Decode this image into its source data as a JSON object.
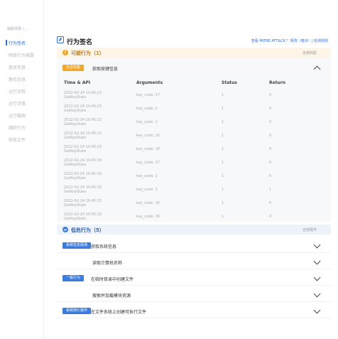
{
  "sidebar": {
    "breadcrumb": "威胁情报 / ...",
    "items": [
      {
        "label": "行为签名",
        "active": true
      },
      {
        "label": "网络行为摘要",
        "active": false
      },
      {
        "label": "基本信息",
        "active": false
      },
      {
        "label": "静态信息",
        "active": false
      },
      {
        "label": "运行流程",
        "active": false
      },
      {
        "label": "运行详情",
        "active": false
      },
      {
        "label": "运行截图",
        "active": false
      },
      {
        "label": "辅助行为",
        "active": false
      },
      {
        "label": "释放文件",
        "active": false
      }
    ]
  },
  "header": {
    "title": "行为签名",
    "link": "查看 MITRE ATT&CK™ 矩阵（暗示）| 检测规则"
  },
  "high_risk": {
    "label": "可疑行为（1）",
    "collapse": "全部收起",
    "group": {
      "tag": "信息收集",
      "text": "获取按键信息"
    },
    "table": {
      "headers": [
        "Time & API",
        "Arguments",
        "Status",
        "Return"
      ],
      "rows": [
        {
          "time": "2022-02-24 10:45:23",
          "api": "GetKeyState",
          "args": "key_code: 17",
          "status": "1",
          "ret": "0"
        },
        {
          "time": "2022-02-24 10:45:23",
          "api": "GetKeyState",
          "args": "key_code: 2",
          "status": "1",
          "ret": "0"
        },
        {
          "time": "2022-02-24 10:45:22",
          "api": "GetKeyState",
          "args": "key_code: 1",
          "status": "1",
          "ret": "0"
        },
        {
          "time": "2022-02-24 10:45:22",
          "api": "GetKeyState",
          "args": "key_code: 16",
          "status": "1",
          "ret": "0"
        },
        {
          "time": "2022-02-24 10:45:23",
          "api": "GetKeyState",
          "args": "key_code: 18",
          "status": "1",
          "ret": "0"
        },
        {
          "time": "2022-02-24 10:45:33",
          "api": "GetKeyState",
          "args": "key_code: 17",
          "status": "1",
          "ret": "0"
        },
        {
          "time": "2022-02-24 10:45:33",
          "api": "GetKeyState",
          "args": "key_code: 2",
          "status": "1",
          "ret": "0"
        },
        {
          "time": "2022-02-24 10:45:33",
          "api": "GetKeyState",
          "args": "key_code: 1",
          "status": "1",
          "ret": "1"
        },
        {
          "time": "2022-02-24 10:45:33",
          "api": "GetKeyState",
          "args": "key_code: 16",
          "status": "1",
          "ret": "0"
        },
        {
          "time": "2022-02-24 10:45:33",
          "api": "GetKeyState",
          "args": "key_code: 18",
          "status": "1",
          "ret": "0"
        }
      ]
    }
  },
  "low_risk": {
    "label": "低危行为（5）",
    "collapse": "全部展开",
    "rows": [
      {
        "tag": "系统信息探测",
        "text": "获取系统信息"
      },
      {
        "tag": "",
        "text": "读取计算机名称"
      },
      {
        "tag": "一般行为",
        "text": "在临时目录中创建文件"
      },
      {
        "tag": "",
        "text": "搜索并加载模块资源"
      },
      {
        "tag": "系统持久操作",
        "text": "在文件系统上创建可执行文件"
      }
    ]
  },
  "colors": {
    "accent": "#2f6fdf",
    "warning": "#f5a623",
    "tag_blue": "#3a7be0"
  }
}
